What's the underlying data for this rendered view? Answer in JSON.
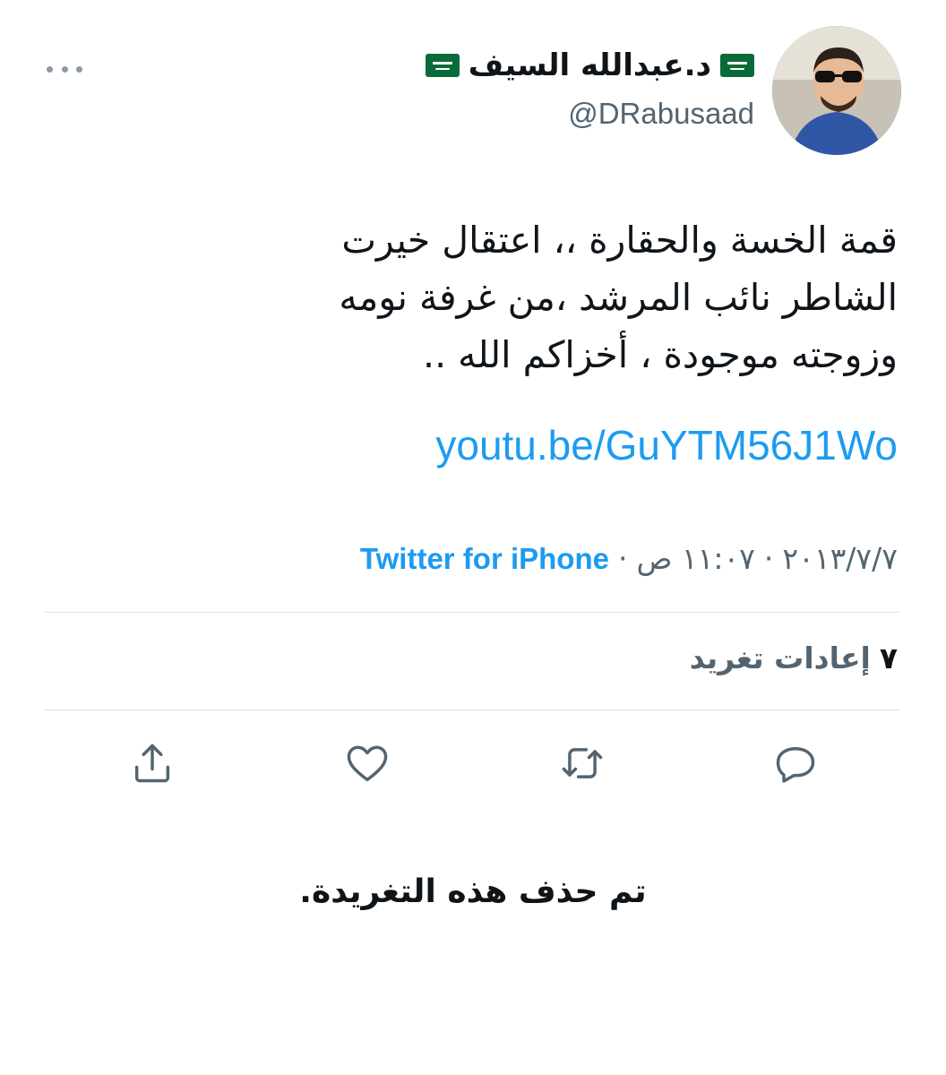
{
  "header": {
    "display_name": "د.عبدالله السيف",
    "handle": "@DRabusaad",
    "more_icon": "more-horizontal-icon",
    "flag_icon": "saudi-flag-icon"
  },
  "tweet": {
    "lines": [
      "قمة الخسة والحقارة ،، اعتقال خيرت",
      "الشاطر نائب المرشد ،من غرفة نومه",
      "وزوجته موجودة ، أخزاكم الله .."
    ],
    "link": "youtu.be/GuYTM56J1Wo"
  },
  "meta": {
    "date": "٢٠١٣/٧/٧",
    "time": "١١:٠٧ ص",
    "separator": "·",
    "source": "Twitter for iPhone"
  },
  "stats": {
    "retweets_count": "٧",
    "retweets_label": "إعادات تغريد"
  },
  "actions": {
    "reply_icon": "reply-icon",
    "retweet_icon": "retweet-icon",
    "like_icon": "heart-icon",
    "share_icon": "share-icon"
  },
  "notice": "تم حذف هذه التغريدة.",
  "colors": {
    "link": "#1d9bf0",
    "secondary_text": "#536471",
    "icon": "#536471",
    "divider": "#dbe1e6"
  }
}
